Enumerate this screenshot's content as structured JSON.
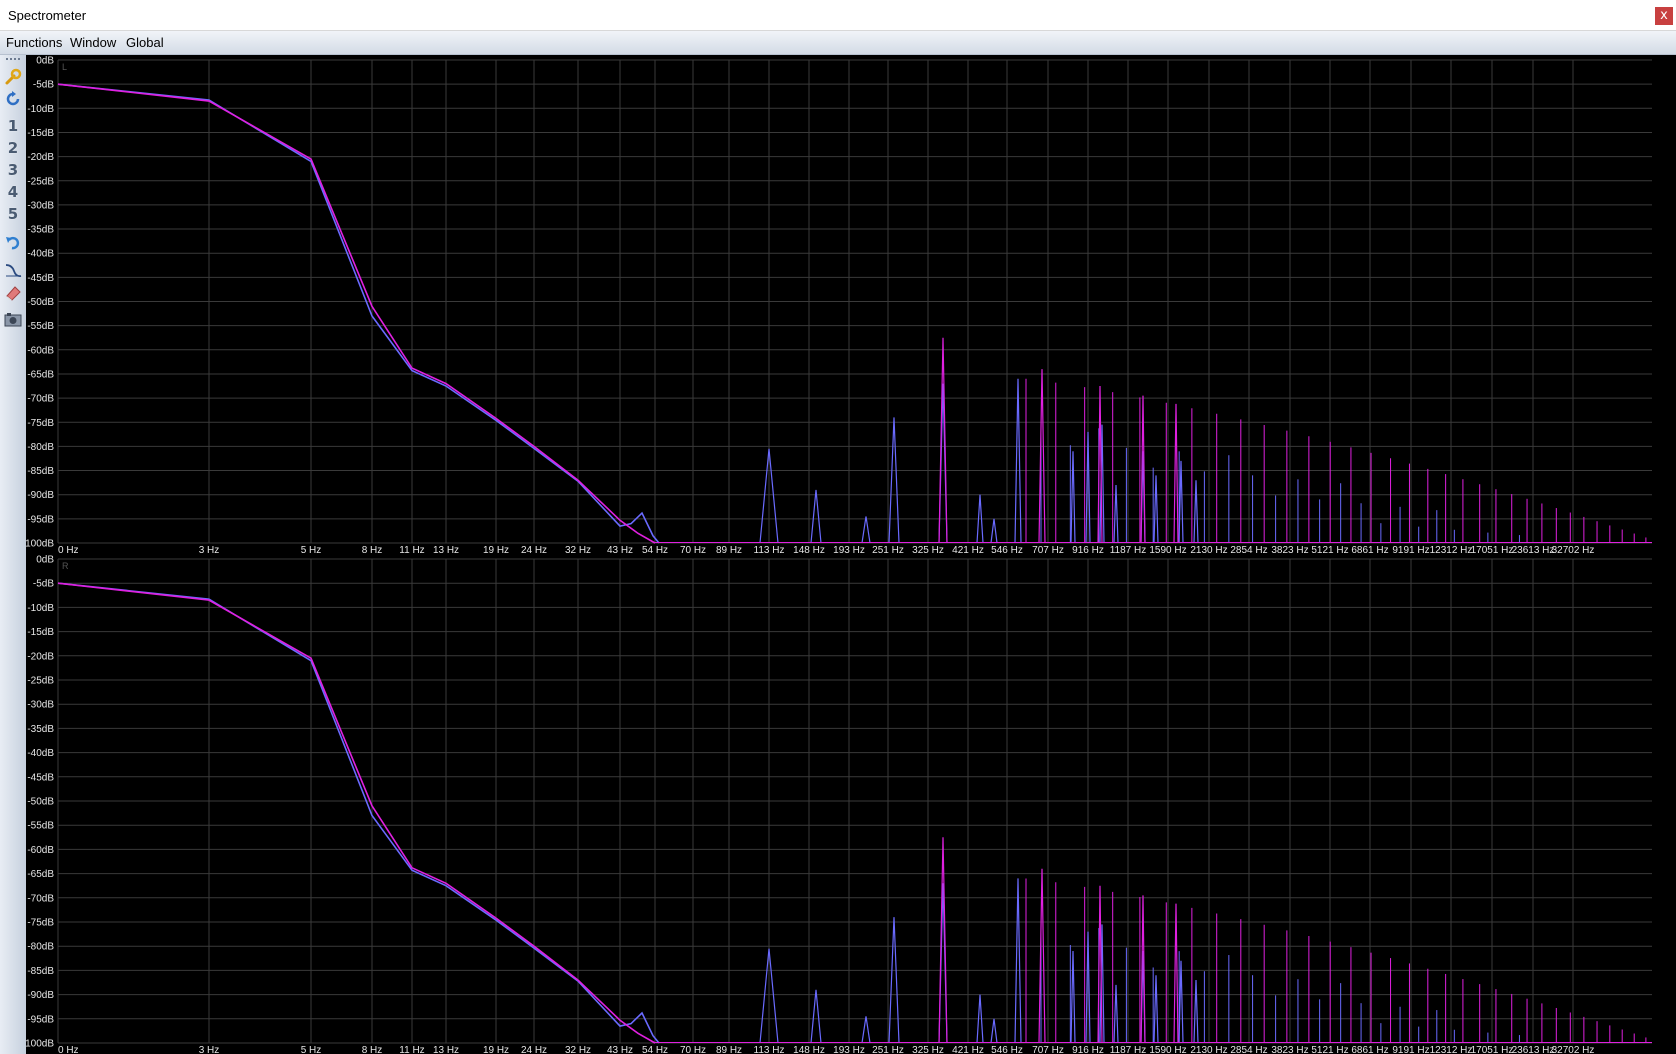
{
  "window": {
    "title": "Spectrometer",
    "close_label": "x"
  },
  "menu": {
    "items": [
      "Functions",
      "Window",
      "Global"
    ]
  },
  "toolbar": {
    "tools": [
      {
        "name": "settings-wrench-icon",
        "glyph": ""
      },
      {
        "name": "refresh-icon",
        "glyph": ""
      },
      {
        "name": "preset-1-button",
        "glyph": "1"
      },
      {
        "name": "preset-2-button",
        "glyph": "2"
      },
      {
        "name": "preset-3-button",
        "glyph": "3"
      },
      {
        "name": "preset-4-button",
        "glyph": "4"
      },
      {
        "name": "preset-5-button",
        "glyph": "5"
      },
      {
        "name": "undo-icon",
        "glyph": ""
      },
      {
        "name": "curve-tool-icon",
        "glyph": ""
      },
      {
        "name": "eraser-icon",
        "glyph": ""
      },
      {
        "name": "snapshot-icon",
        "glyph": ""
      }
    ]
  },
  "colors": {
    "series_a": "#e020e0",
    "series_b": "#6a6aff",
    "grid": "#3a3a3a",
    "background": "#000000"
  },
  "chart_data": [
    {
      "type": "line",
      "channel": "L",
      "y_ticks": [
        "0dB",
        "-5dB",
        "-10dB",
        "-15dB",
        "-20dB",
        "-25dB",
        "-30dB",
        "-35dB",
        "-40dB",
        "-45dB",
        "-50dB",
        "-55dB",
        "-60dB",
        "-65dB",
        "-70dB",
        "-75dB",
        "-80dB",
        "-85dB",
        "-90dB",
        "-95dB",
        "-100dB"
      ],
      "x_ticks": [
        "0 Hz",
        "3 Hz",
        "5 Hz",
        "8 Hz",
        "11 Hz",
        "13 Hz",
        "19 Hz",
        "24 Hz",
        "32 Hz",
        "43 Hz",
        "54 Hz",
        "70 Hz",
        "89 Hz",
        "113 Hz",
        "148 Hz",
        "193 Hz",
        "251 Hz",
        "325 Hz",
        "421 Hz",
        "546 Hz",
        "707 Hz",
        "916 Hz",
        "1187 Hz",
        "1590 Hz",
        "2130 Hz",
        "2854 Hz",
        "3823 Hz",
        "5121 Hz",
        "6861 Hz",
        "9191 Hz",
        "12312 Hz",
        "17051 Hz",
        "23613 Hz",
        "32702 Hz"
      ],
      "ylim": [
        -100,
        0
      ],
      "grid": true
    },
    {
      "type": "line",
      "channel": "R",
      "y_ticks": [
        "0dB",
        "-5dB",
        "-10dB",
        "-15dB",
        "-20dB",
        "-25dB",
        "-30dB",
        "-35dB",
        "-40dB",
        "-45dB",
        "-50dB",
        "-55dB",
        "-60dB",
        "-65dB",
        "-70dB",
        "-75dB",
        "-80dB",
        "-85dB",
        "-90dB",
        "-95dB",
        "-100dB"
      ],
      "x_ticks": [
        "0 Hz",
        "3 Hz",
        "5 Hz",
        "8 Hz",
        "11 Hz",
        "13 Hz",
        "19 Hz",
        "24 Hz",
        "32 Hz",
        "43 Hz",
        "54 Hz",
        "70 Hz",
        "89 Hz",
        "113 Hz",
        "148 Hz",
        "193 Hz",
        "251 Hz",
        "325 Hz",
        "421 Hz",
        "546 Hz",
        "707 Hz",
        "916 Hz",
        "1187 Hz",
        "1590 Hz",
        "2130 Hz",
        "2854 Hz",
        "3823 Hz",
        "5121 Hz",
        "6861 Hz",
        "9191 Hz",
        "12312 Hz",
        "17051 Hz",
        "23613 Hz",
        "32702 Hz"
      ],
      "ylim": [
        -100,
        0
      ],
      "grid": true
    }
  ]
}
